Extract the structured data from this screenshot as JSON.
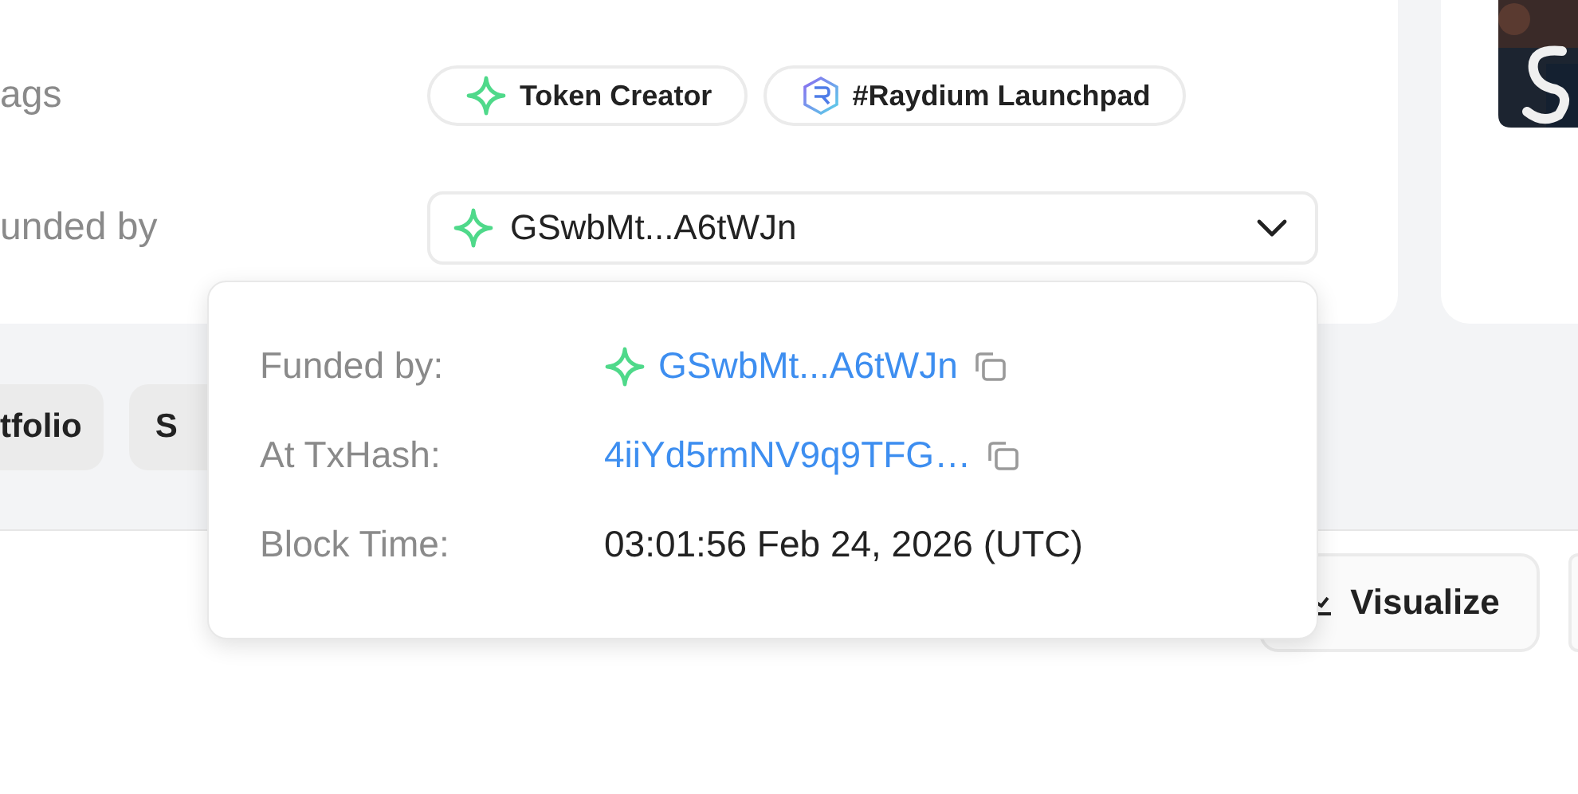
{
  "details": {
    "rows": [
      {
        "label": "ags",
        "kind": "tags",
        "tags": [
          {
            "label": "Token Creator",
            "kind": "creator"
          },
          {
            "label": "#Raydium Launchpad",
            "kind": "launchpad"
          }
        ]
      },
      {
        "label": "unded by",
        "kind": "select",
        "value": "GSwbMt...A6tWJn"
      }
    ]
  },
  "tabs": [
    {
      "label": "tfolio"
    },
    {
      "label": "S"
    }
  ],
  "toolbar": {
    "buttons": [
      {
        "label": "Visualize",
        "kind": "chart"
      },
      {
        "kind": "partial"
      }
    ]
  },
  "popup": {
    "rows": [
      {
        "label": "Funded by:",
        "value": "GSwbMt...A6tWJn",
        "kind": "address"
      },
      {
        "label": "At TxHash:",
        "value": "4iiYd5rmNV9q9TFG…",
        "kind": "hash"
      },
      {
        "label": "Block Time:",
        "value": "03:01:56 Feb 24, 2026 (UTC)",
        "kind": "text"
      }
    ]
  }
}
